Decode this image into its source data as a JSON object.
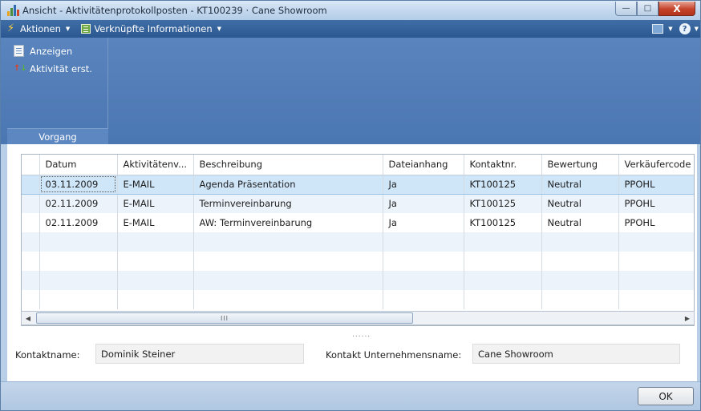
{
  "window": {
    "title": "Ansicht - Aktivitätenprotokollposten - KT100239 · Cane Showroom",
    "controls": {
      "minimize": "—",
      "maximize": "□",
      "close": "X"
    }
  },
  "command_bar": {
    "actions_label": "Aktionen",
    "related_label": "Verknüpfte Informationen",
    "help_label": "?"
  },
  "ribbon": {
    "group_label": "Vorgang",
    "items": [
      {
        "label": "Anzeigen",
        "icon": "document-view-icon"
      },
      {
        "label": "Aktivität erst.",
        "icon": "arrows-icon"
      }
    ]
  },
  "grid": {
    "columns": [
      "Datum",
      "Aktivitätenv...",
      "Beschreibung",
      "Dateianhang",
      "Kontaktnr.",
      "Bewertung",
      "Verkäufercode"
    ],
    "rows": [
      [
        "03.11.2009",
        "E-MAIL",
        "Agenda Präsentation",
        "Ja",
        "KT100125",
        "Neutral",
        "PPOHL"
      ],
      [
        "02.11.2009",
        "E-MAIL",
        "Terminvereinbarung",
        "Ja",
        "KT100125",
        "Neutral",
        "PPOHL"
      ],
      [
        "02.11.2009",
        "E-MAIL",
        "AW: Terminvereinbarung",
        "Ja",
        "KT100125",
        "Neutral",
        "PPOHL"
      ]
    ],
    "selected_row": 0,
    "scroll_grip": "III"
  },
  "splitter_text": "......",
  "fields": {
    "contact_name_label": "Kontaktname:",
    "contact_name_value": "Dominik Steiner",
    "company_name_label": "Kontakt Unternehmensname:",
    "company_name_value": "Cane Showroom"
  },
  "footer": {
    "ok_label": "OK"
  },
  "colors": {
    "ribbon": "#4a76b2",
    "command_bar": "#2c5892",
    "selected_row": "#cfe5f8"
  }
}
